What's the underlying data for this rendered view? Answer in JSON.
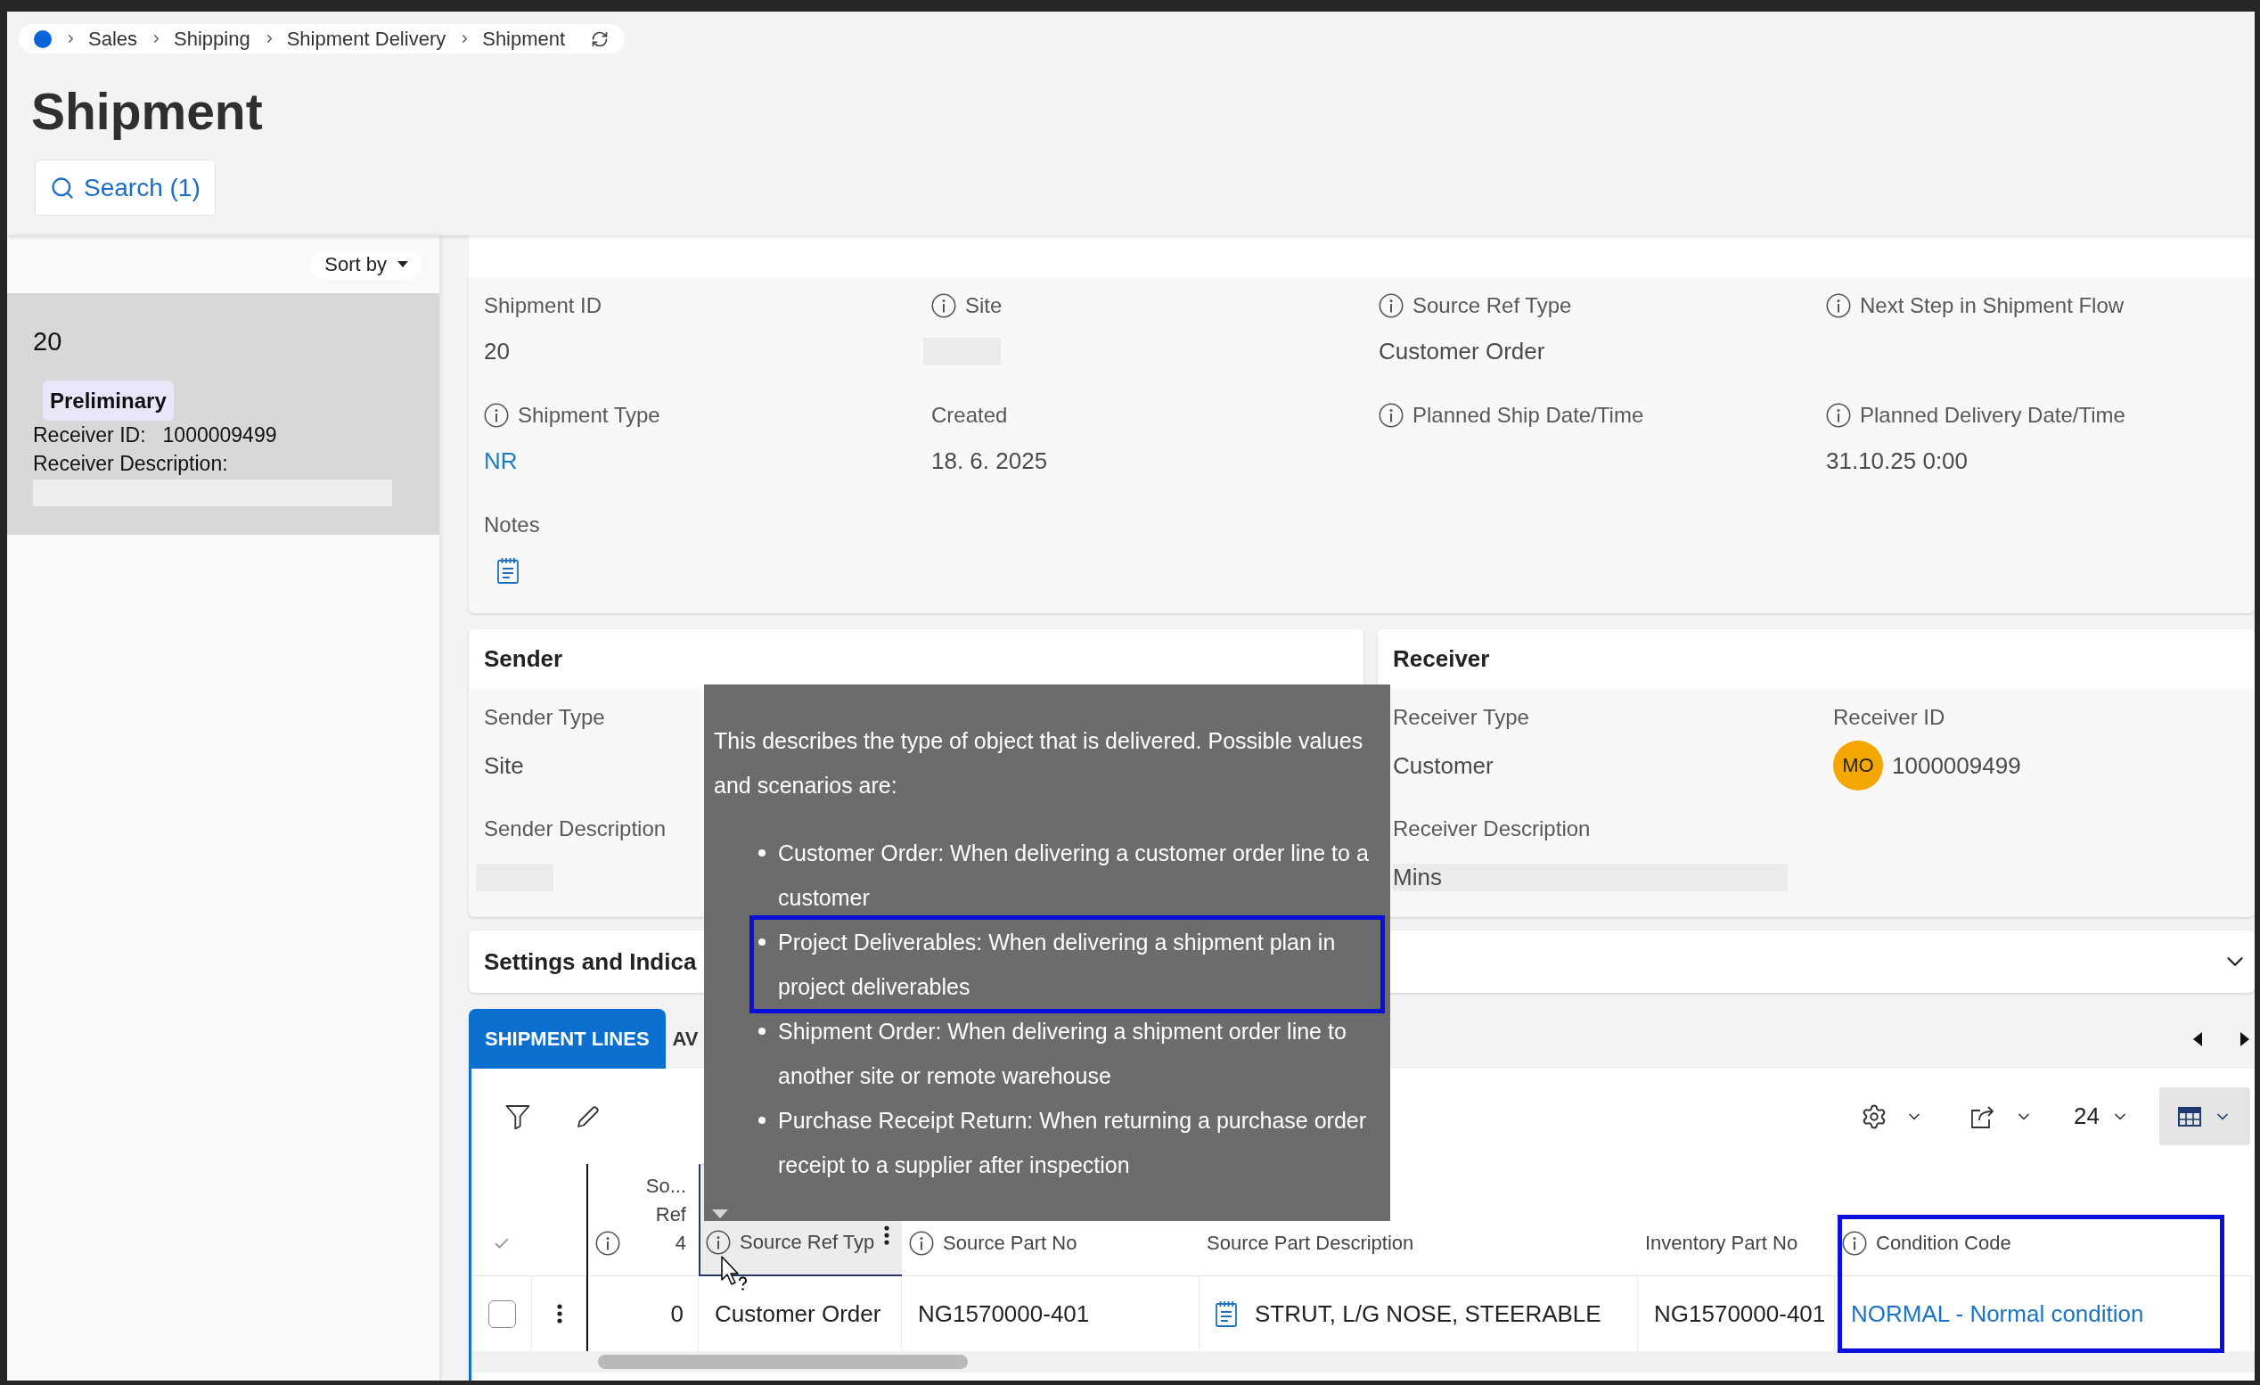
{
  "breadcrumb": {
    "items": [
      "Sales",
      "Shipping",
      "Shipment Delivery",
      "Shipment"
    ]
  },
  "page_title": "Shipment",
  "search_button": {
    "label": "Search (1)"
  },
  "list_panel": {
    "sort_label": "Sort by",
    "records": [
      {
        "selected": true,
        "id": "20",
        "status": "Preliminary",
        "receiver_id_label": "Receiver ID:",
        "receiver_id": "1000009499",
        "receiver_description_label": "Receiver Description:"
      }
    ]
  },
  "header_fields": [
    {
      "label": "Shipment ID",
      "info": false,
      "kind": "text",
      "value": "20"
    },
    {
      "label": "Site",
      "info": true,
      "kind": "redacted"
    },
    {
      "label": "Source Ref Type",
      "info": true,
      "kind": "text",
      "value": "Customer Order"
    },
    {
      "label": "Next Step in Shipment Flow",
      "info": true,
      "kind": "text"
    },
    {
      "label": "Shipment Type",
      "info": true,
      "kind": "link",
      "value": "NR"
    },
    {
      "label": "Created",
      "info": false,
      "kind": "text",
      "value": "18. 6. 2025"
    },
    {
      "label": "Planned Ship Date/Time",
      "info": true,
      "kind": "text"
    },
    {
      "label": "Planned Delivery Date/Time",
      "info": true,
      "kind": "text",
      "value": "31.10.25 0:00"
    },
    {
      "label": "Notes",
      "info": false,
      "kind": "notes"
    }
  ],
  "sender": {
    "title": "Sender",
    "rows": [
      [
        {
          "label": "Sender Type",
          "kind": "text",
          "value": "Site"
        }
      ],
      [
        {
          "label": "Sender Description",
          "kind": "redacted"
        }
      ]
    ]
  },
  "receiver": {
    "title": "Receiver",
    "rows": [
      [
        {
          "label": "Receiver Type",
          "kind": "text",
          "value": "Customer"
        },
        {
          "label": "Receiver ID",
          "kind": "avatar",
          "avatar": "MO",
          "value": "1000009499"
        }
      ],
      [
        {
          "label": "Receiver Description",
          "kind": "redacted",
          "value": "Mins"
        }
      ]
    ]
  },
  "settings_section": {
    "title": "Settings and Indica",
    "expanded": false
  },
  "tabs": [
    {
      "label": "SHIPMENT LINES",
      "selected": true
    },
    {
      "label": "AV",
      "selected": false
    }
  ],
  "table_toolbar": {
    "page_size": "24"
  },
  "table": {
    "columns": [
      {
        "label_lines": [
          "So...",
          "Ref",
          "4"
        ],
        "info": true,
        "kind": "number",
        "hovered": false,
        "highlighted": false
      },
      {
        "label_lines": [
          "Source Ref Typ"
        ],
        "info": true,
        "kind": "text",
        "hovered": true,
        "highlighted": false
      },
      {
        "label_lines": [
          "Source Part No"
        ],
        "info": true,
        "kind": "text",
        "hovered": false,
        "highlighted": false
      },
      {
        "label_lines": [
          "Source Part Description"
        ],
        "info": false,
        "kind": "notes_text",
        "hovered": false,
        "highlighted": false
      },
      {
        "label_lines": [
          "Inventory Part No"
        ],
        "info": false,
        "kind": "text",
        "hovered": false,
        "highlighted": false
      },
      {
        "label_lines": [
          "Condition Code"
        ],
        "info": true,
        "kind": "link",
        "hovered": false,
        "highlighted": true
      }
    ],
    "rows": [
      {
        "checked": false,
        "cells": [
          "0",
          "Customer Order",
          "NG1570000-401",
          "STRUT, L/G NOSE, STEERABLE",
          "NG1570000-401",
          "NORMAL - Normal condition"
        ]
      }
    ]
  },
  "tooltip": {
    "intro": "This describes the type of object that is delivered. Possible values and scenarios are:",
    "items": [
      {
        "text": "Customer Order: When delivering a customer order line to a customer",
        "highlighted": false
      },
      {
        "text": "Project Deliverables: When delivering a shipment plan in project deliverables",
        "highlighted": true
      },
      {
        "text": "Shipment Order: When delivering a shipment order line to another site or remote warehouse",
        "highlighted": false
      },
      {
        "text": "Purchase Receipt Return: When returning a purchase order receipt to a supplier after inspection",
        "highlighted": false
      }
    ]
  }
}
